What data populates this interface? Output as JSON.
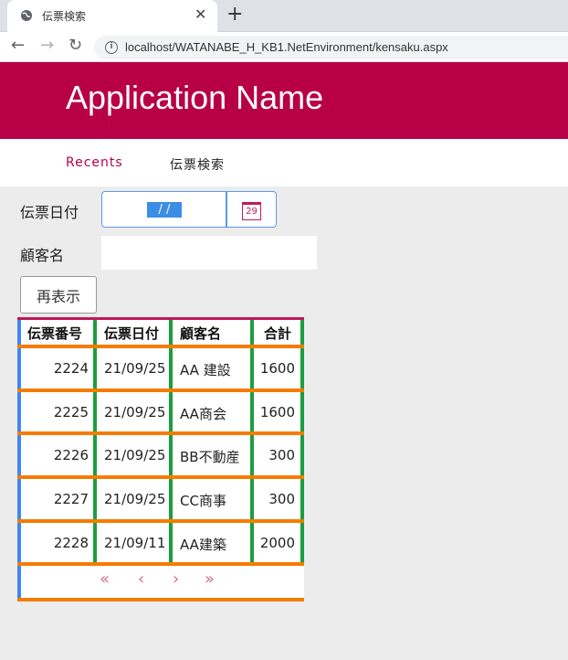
{
  "browser": {
    "tab_title": "伝票検索",
    "tab_close": "✕",
    "new_tab": "+",
    "back": "←",
    "forward": "→",
    "reload": "↻",
    "info": "i",
    "url": "localhost/WATANABE_H_KB1.NetEnvironment/kensaku.aspx"
  },
  "header": {
    "app_name": "Application Name",
    "brand_color": "#b80046"
  },
  "nav": {
    "recents": "Recents",
    "current": "伝票検索"
  },
  "form": {
    "date_label": "伝票日付",
    "date_value": " /  / ",
    "calendar_day": "29",
    "customer_label": "顧客名",
    "customer_value": "",
    "refresh_label": "再表示"
  },
  "table": {
    "columns": [
      "伝票番号",
      "伝票日付",
      "顧客名",
      "合計"
    ],
    "rows": [
      [
        "2224",
        "21/09/25",
        "AA 建設",
        "1600"
      ],
      [
        "2225",
        "21/09/25",
        "AA商会",
        "1600"
      ],
      [
        "2226",
        "21/09/25",
        "BB不動産",
        "300"
      ],
      [
        "2227",
        "21/09/25",
        "CC商事",
        "300"
      ],
      [
        "2228",
        "21/09/11",
        "AA建築",
        "2000"
      ]
    ],
    "pager": {
      "first": "«",
      "prev": "‹",
      "next": "›",
      "last": "»"
    }
  }
}
